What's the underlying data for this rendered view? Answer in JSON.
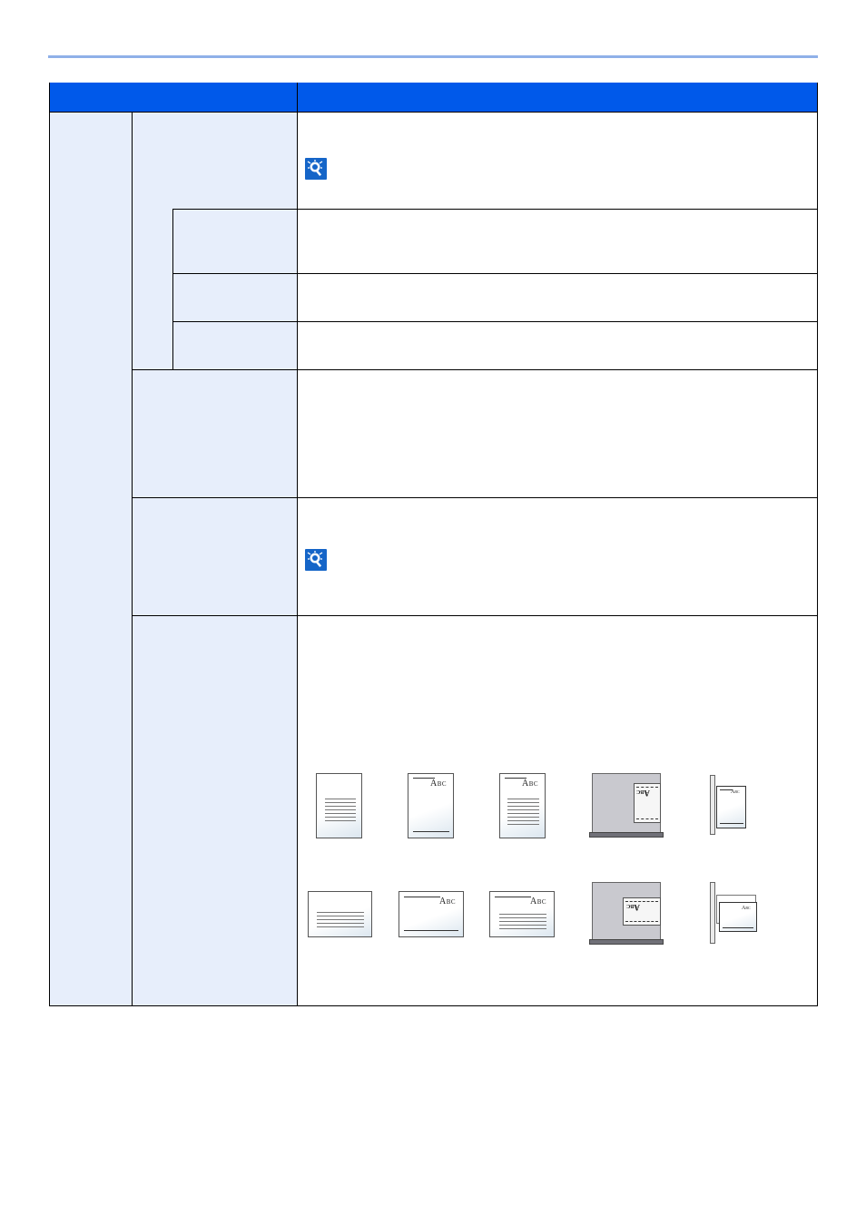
{
  "diagram": {
    "portrait_row": [
      {
        "kind": "lines-only"
      },
      {
        "kind": "text-abc",
        "label": "ABC"
      },
      {
        "kind": "text-abc-lines",
        "label": "ABC"
      },
      {
        "kind": "glass"
      },
      {
        "kind": "feeder",
        "label": "ABC"
      }
    ],
    "landscape_row": [
      {
        "kind": "lines-only"
      },
      {
        "kind": "text-abc",
        "label": "ABC"
      },
      {
        "kind": "text-abc-lines",
        "label": "ABC"
      },
      {
        "kind": "glass"
      },
      {
        "kind": "feeder",
        "label": "ABC"
      }
    ]
  },
  "colors": {
    "header": "#0059ea",
    "label_cell": "#e7eefb",
    "top_rule": "#8fb0e8",
    "note_icon": "#1565c8"
  },
  "icons": [
    "note-icon"
  ]
}
